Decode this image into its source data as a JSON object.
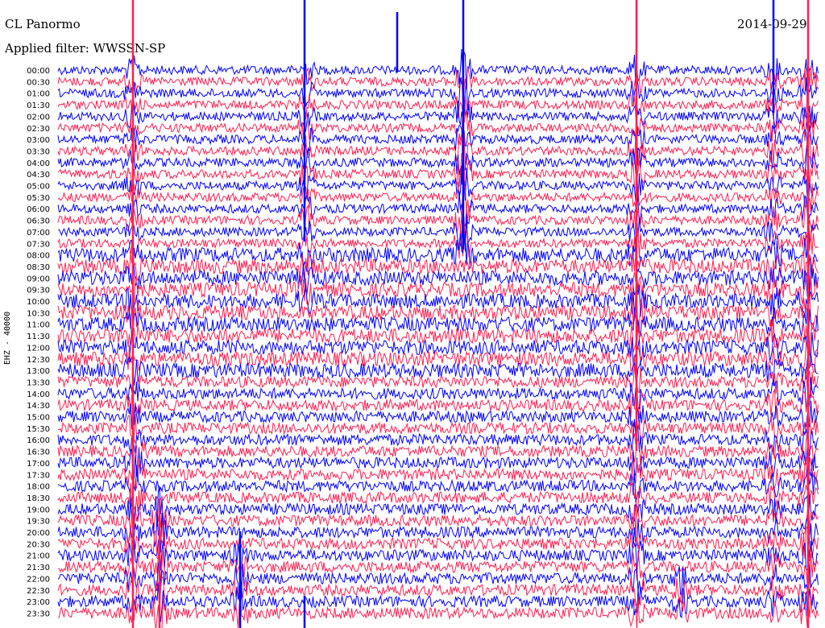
{
  "header": {
    "station": "CL Panormo",
    "filter": "Applied filter: WWSSN-SP",
    "date": "2014-09-29"
  },
  "axis": {
    "ylabel": "EHZ - 40000"
  },
  "colors": {
    "trace_a": "#0000ff",
    "trace_b": "#ff1f4f",
    "background": "#ffffff"
  },
  "chart_data": {
    "type": "line",
    "title": "CL Panormo",
    "subtitle": "Applied filter: WWSSN-SP",
    "date": "2014-09-29",
    "ylabel": "EHZ - 40000",
    "grid": false,
    "row_labels": [
      "00:00",
      "00:30",
      "01:00",
      "01:30",
      "02:00",
      "02:30",
      "03:00",
      "03:30",
      "04:00",
      "04:30",
      "05:00",
      "05:30",
      "06:00",
      "06:30",
      "07:00",
      "07:30",
      "08:00",
      "08:30",
      "09:00",
      "09:30",
      "10:00",
      "10:30",
      "11:00",
      "11:30",
      "12:00",
      "12:30",
      "13:00",
      "13:30",
      "14:00",
      "14:30",
      "15:00",
      "15:30",
      "16:00",
      "16:30",
      "17:00",
      "17:30",
      "18:00",
      "18:30",
      "19:00",
      "19:30",
      "20:00",
      "20:30",
      "21:00",
      "21:30",
      "22:00",
      "22:30",
      "23:00",
      "23:30"
    ],
    "series": [
      {
        "values": []
      },
      {
        "values": []
      }
    ]
  }
}
